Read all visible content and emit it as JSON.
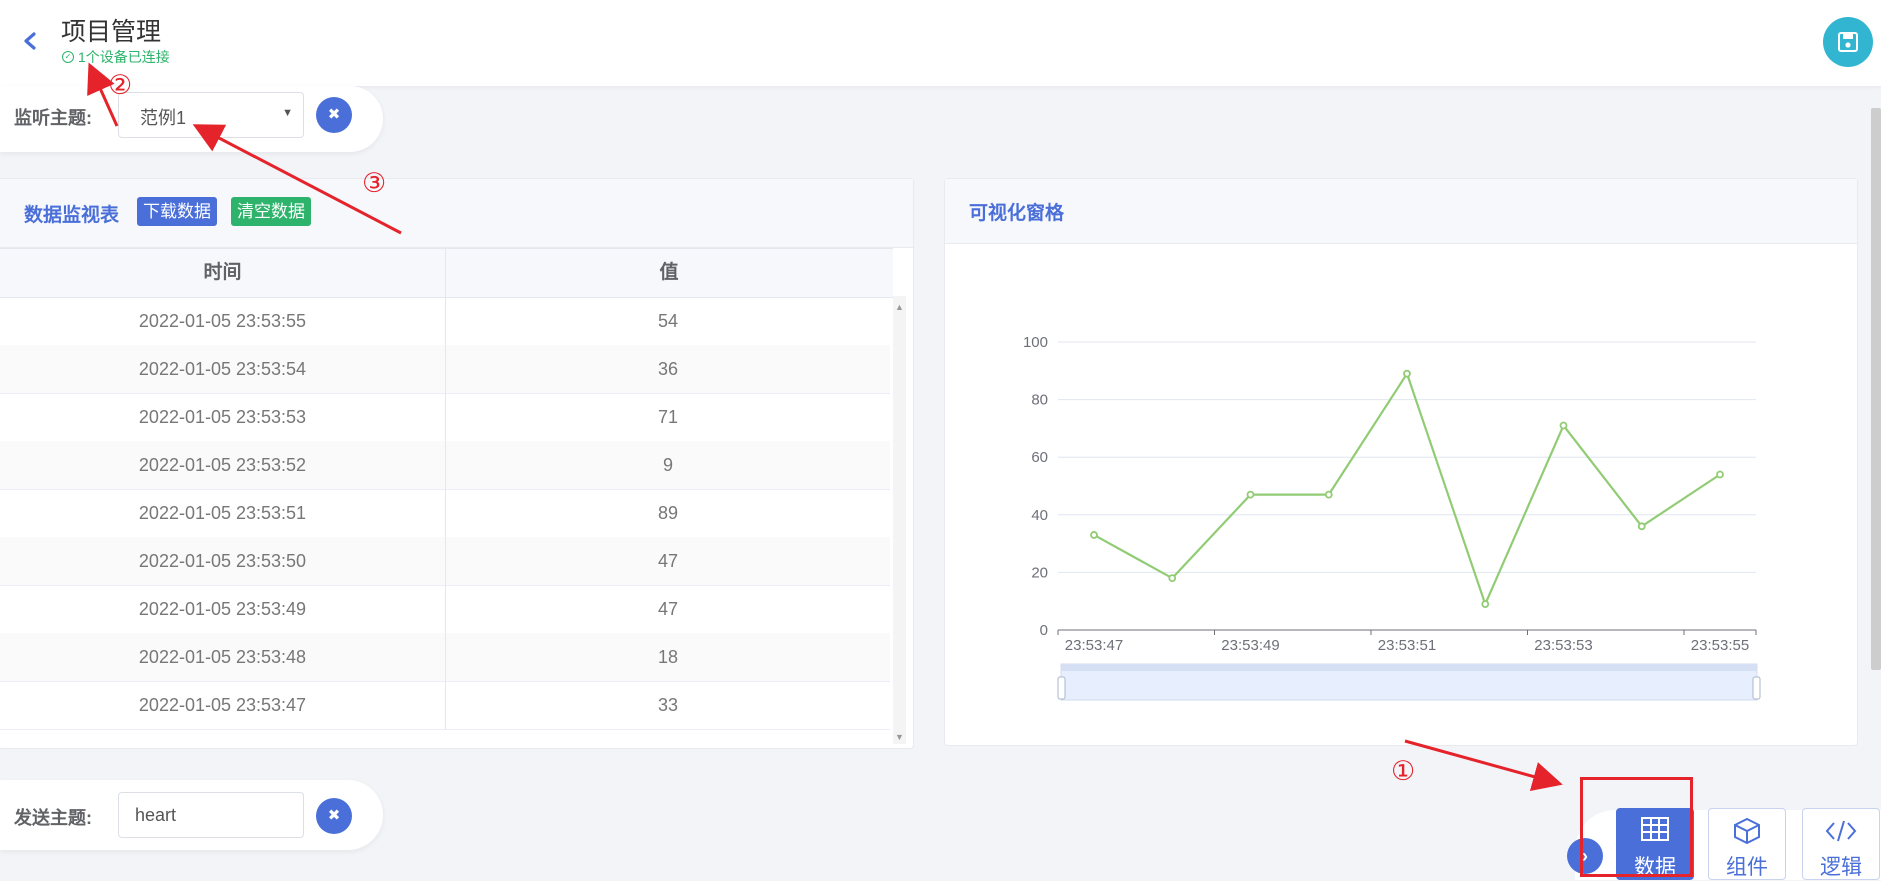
{
  "header": {
    "title": "项目管理",
    "status": "1个设备已连接"
  },
  "listen": {
    "label": "监听主题:",
    "selected": "范例1"
  },
  "monitor": {
    "title": "数据监视表",
    "download_label": "下载数据",
    "clear_label": "清空数据",
    "columns": [
      "时间",
      "值"
    ],
    "rows": [
      {
        "time": "2022-01-05 23:53:55",
        "value": "54"
      },
      {
        "time": "2022-01-05 23:53:54",
        "value": "36"
      },
      {
        "time": "2022-01-05 23:53:53",
        "value": "71"
      },
      {
        "time": "2022-01-05 23:53:52",
        "value": "9"
      },
      {
        "time": "2022-01-05 23:53:51",
        "value": "89"
      },
      {
        "time": "2022-01-05 23:53:50",
        "value": "47"
      },
      {
        "time": "2022-01-05 23:53:49",
        "value": "47"
      },
      {
        "time": "2022-01-05 23:53:48",
        "value": "18"
      },
      {
        "time": "2022-01-05 23:53:47",
        "value": "33"
      }
    ]
  },
  "viz": {
    "title": "可视化窗格"
  },
  "chart_data": {
    "type": "line",
    "x": [
      "23:53:47",
      "23:53:48",
      "23:53:49",
      "23:53:50",
      "23:53:51",
      "23:53:52",
      "23:53:53",
      "23:53:54",
      "23:53:55"
    ],
    "series": [
      {
        "values": [
          33,
          18,
          47,
          47,
          89,
          9,
          71,
          36,
          54
        ]
      }
    ],
    "x_tick_labels": [
      "23:53:47",
      "23:53:49",
      "23:53:51",
      "23:53:53",
      "23:53:55"
    ],
    "y_ticks": [
      "0",
      "20",
      "40",
      "60",
      "80",
      "100"
    ],
    "ylim": [
      0,
      100
    ],
    "grid": true,
    "line_color": "#91cc75",
    "has_datazoom_slider": true
  },
  "send": {
    "label": "发送主题:",
    "value": "heart"
  },
  "bottom_tabs": [
    {
      "label": "数据",
      "icon": "table-icon",
      "active": true
    },
    {
      "label": "组件",
      "icon": "cube-icon",
      "active": false
    },
    {
      "label": "逻辑",
      "icon": "code-icon",
      "active": false
    }
  ],
  "annotations": [
    "②",
    "③",
    "①"
  ],
  "colors": {
    "accent": "#4a6fd8",
    "success": "#2db36b",
    "save": "#31b5d0",
    "annotation": "#e5232b"
  }
}
